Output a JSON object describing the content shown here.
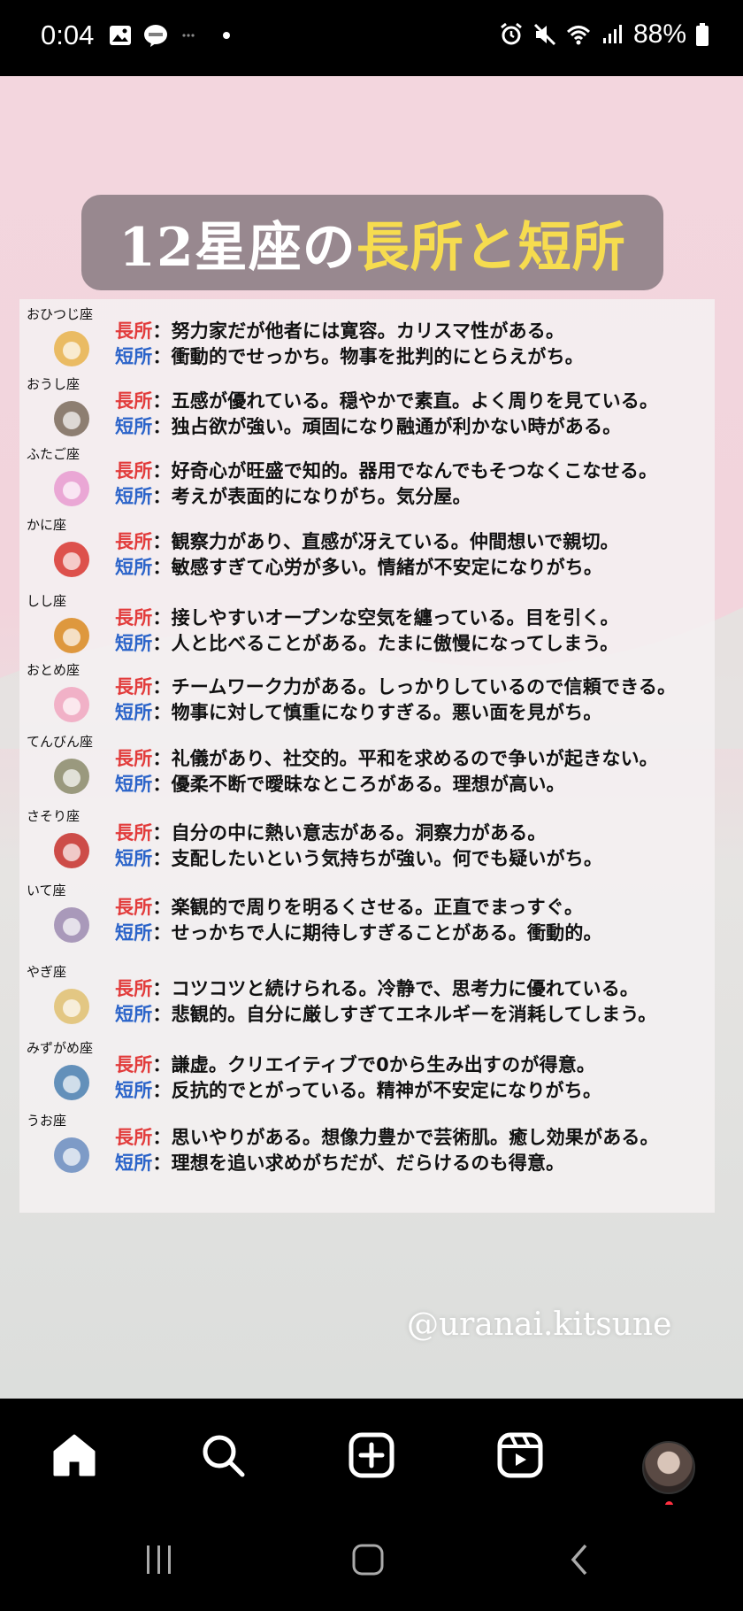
{
  "status": {
    "time": "0:04",
    "battery": "88%"
  },
  "post": {
    "title_white": "12星座の",
    "title_yellow": "長所と短所",
    "watermark": "@uranai.kitsune",
    "long_label": "長所",
    "short_label": "短所",
    "signs": [
      {
        "name": "おひつじ座",
        "icon": "ram-icon",
        "long": "：努力家だが他者には寛容。カリスマ性がある。",
        "short": "：衝動的でせっかち。物事を批判的にとらえがち。"
      },
      {
        "name": "おうし座",
        "icon": "bull-icon",
        "long": "：五感が優れている。穏やかで素直。よく周りを見ている。",
        "short": "：独占欲が強い。頑固になり融通が利かない時がある。"
      },
      {
        "name": "ふたご座",
        "icon": "twins-icon",
        "long": "：好奇心が旺盛で知的。器用でなんでもそつなくこなせる。",
        "short": "：考えが表面的になりがち。気分屋。"
      },
      {
        "name": "かに座",
        "icon": "crab-icon",
        "long": "：観察力があり、直感が冴えている。仲間想いで親切。",
        "short": "：敏感すぎて心労が多い。情緒が不安定になりがち。"
      },
      {
        "name": "しし座",
        "icon": "lion-icon",
        "long": "：接しやすいオープンな空気を纏っている。目を引く。",
        "short": "：人と比べることがある。たまに傲慢になってしまう。"
      },
      {
        "name": "おとめ座",
        "icon": "maiden-icon",
        "long": "：チームワーク力がある。しっかりしているので信頼できる。",
        "short": "：物事に対して慎重になりすぎる。悪い面を見がち。"
      },
      {
        "name": "てんびん座",
        "icon": "scales-icon",
        "long": "：礼儀があり、社交的。平和を求めるので争いが起きない。",
        "short": "：優柔不断で曖昧なところがある。理想が高い。"
      },
      {
        "name": "さそり座",
        "icon": "scorpion-icon",
        "long": "：自分の中に熱い意志がある。洞察力がある。",
        "short": "：支配したいという気持ちが強い。何でも疑いがち。"
      },
      {
        "name": "いて座",
        "icon": "bow-icon",
        "long": "：楽観的で周りを明るくさせる。正直でまっすぐ。",
        "short": "：せっかちで人に期待しすぎることがある。衝動的。"
      },
      {
        "name": "やぎ座",
        "icon": "goat-icon",
        "long": "：コツコツと続けられる。冷静で、思考力に優れている。",
        "short": "：悲観的。自分に厳しすぎてエネルギーを消耗してしまう。"
      },
      {
        "name": "みずがめ座",
        "icon": "water-jar-icon",
        "long": "：謙虚。クリエイティブで0から生み出すのが得意。",
        "short": "：反抗的でとがっている。精神が不安定になりがち。"
      },
      {
        "name": "うお座",
        "icon": "fish-icon",
        "long": "：思いやりがある。想像力豊かで芸術肌。癒し効果がある。",
        "short": "：理想を追い求めがちだが、だらけるのも得意。"
      }
    ]
  },
  "nav": {
    "items": [
      "home-icon",
      "search-icon",
      "create-icon",
      "reels-icon",
      "profile-avatar"
    ]
  },
  "colors": {
    "long_label": "#e23b3b",
    "short_label": "#2a63c9",
    "title_highlight": "#f6dc4f"
  }
}
